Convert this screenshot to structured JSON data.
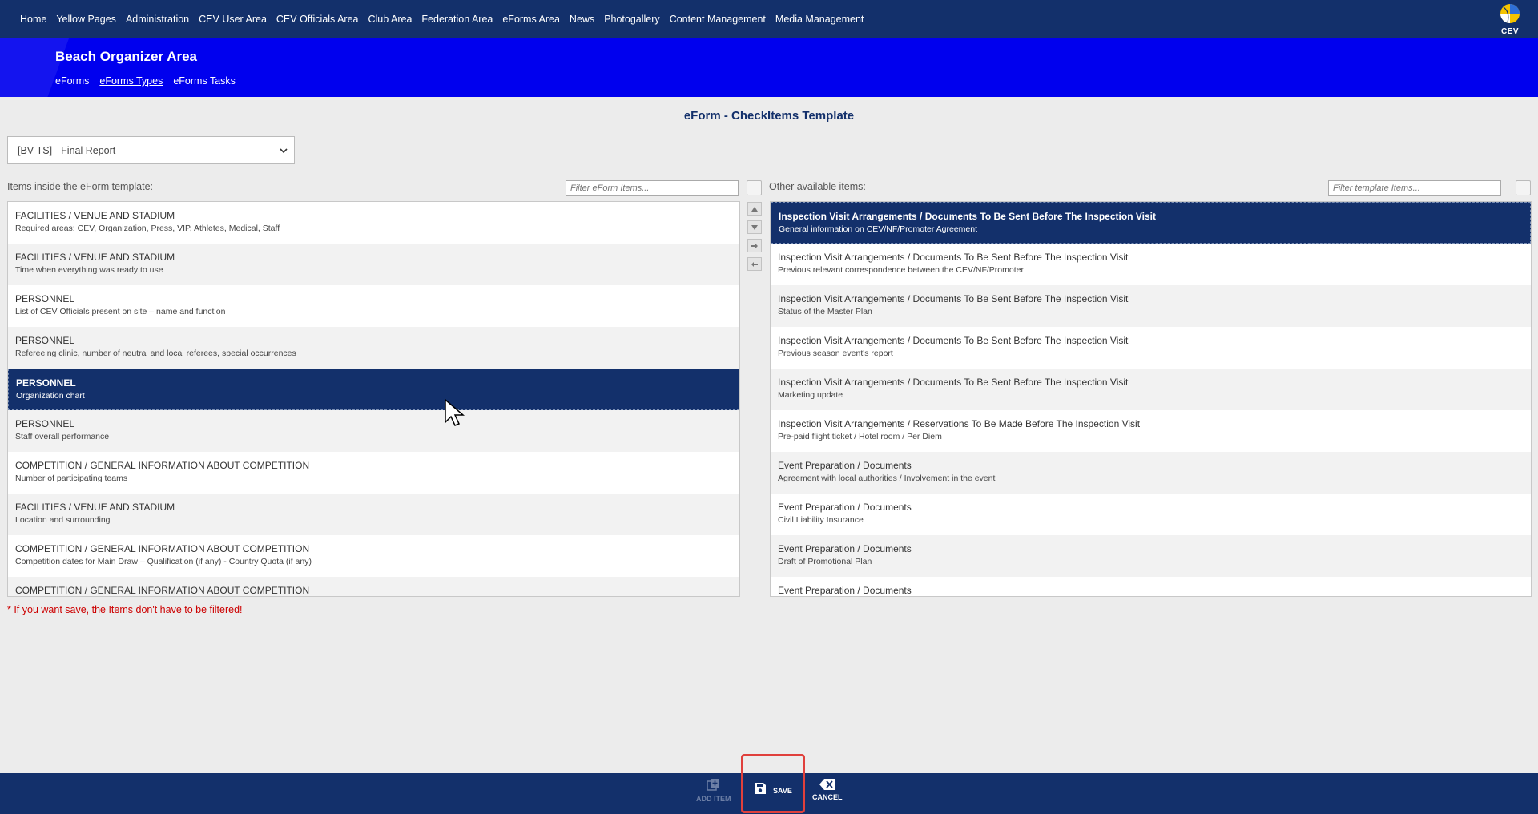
{
  "topnav": {
    "items": [
      "Home",
      "Yellow Pages",
      "Administration",
      "CEV User Area",
      "CEV Officials Area",
      "Club Area",
      "Federation Area",
      "eForms Area",
      "News",
      "Photogallery",
      "Content Management",
      "Media Management"
    ],
    "logo_text": "CEV"
  },
  "banner": {
    "title": "Beach Organizer Area",
    "links": [
      "eForms",
      "eForms Types",
      "eForms Tasks"
    ],
    "active_link": "eForms Types"
  },
  "page_title": "eForm - CheckItems Template",
  "form_select": {
    "value": "[BV-TS] - Final Report"
  },
  "left_panel": {
    "label": "Items inside the eForm template:",
    "filter_placeholder": "Filter eForm Items...",
    "items": [
      {
        "title": "FACILITIES / VENUE AND STADIUM",
        "sub": "Required areas: CEV, Organization, Press, VIP, Athletes, Medical, Staff",
        "selected": false
      },
      {
        "title": "FACILITIES / VENUE AND STADIUM",
        "sub": "Time when everything was ready to use",
        "selected": false
      },
      {
        "title": "PERSONNEL",
        "sub": "List of CEV Officials present on site – name and function",
        "selected": false
      },
      {
        "title": "PERSONNEL",
        "sub": "Refereeing clinic, number of neutral and local referees, special occurrences",
        "selected": false
      },
      {
        "title": "PERSONNEL",
        "sub": "Organization chart",
        "selected": true
      },
      {
        "title": "PERSONNEL",
        "sub": "Staff overall performance",
        "selected": false
      },
      {
        "title": "COMPETITION / GENERAL INFORMATION ABOUT COMPETITION",
        "sub": "Number of participating teams",
        "selected": false
      },
      {
        "title": "FACILITIES / VENUE AND STADIUM",
        "sub": "Location and surrounding",
        "selected": false
      },
      {
        "title": "COMPETITION / GENERAL INFORMATION ABOUT COMPETITION",
        "sub": "Competition dates for Main Draw – Qualification (if any) - Country Quota (if any)",
        "selected": false
      },
      {
        "title": "COMPETITION / GENERAL INFORMATION ABOUT COMPETITION",
        "sub": "",
        "selected": false
      }
    ]
  },
  "right_panel": {
    "label": "Other available items:",
    "filter_placeholder": "Filter template Items...",
    "items": [
      {
        "title": "Inspection Visit Arrangements / Documents To Be Sent Before The Inspection Visit",
        "sub": "General information on CEV/NF/Promoter Agreement",
        "selected": true
      },
      {
        "title": "Inspection Visit Arrangements / Documents To Be Sent Before The Inspection Visit",
        "sub": "Previous relevant correspondence between the CEV/NF/Promoter",
        "selected": false
      },
      {
        "title": "Inspection Visit Arrangements / Documents To Be Sent Before The Inspection Visit",
        "sub": "Status of the Master Plan",
        "selected": false
      },
      {
        "title": "Inspection Visit Arrangements / Documents To Be Sent Before The Inspection Visit",
        "sub": "Previous season event's report",
        "selected": false
      },
      {
        "title": "Inspection Visit Arrangements / Documents To Be Sent Before The Inspection Visit",
        "sub": "Marketing update",
        "selected": false
      },
      {
        "title": "Inspection Visit Arrangements / Reservations To Be Made Before The Inspection Visit",
        "sub": "Pre-paid flight ticket / Hotel room / Per Diem",
        "selected": false
      },
      {
        "title": "Event Preparation / Documents",
        "sub": "Agreement with local authorities / Involvement in the event",
        "selected": false
      },
      {
        "title": "Event Preparation / Documents",
        "sub": "Civil Liability Insurance",
        "selected": false
      },
      {
        "title": "Event Preparation / Documents",
        "sub": "Draft of Promotional Plan",
        "selected": false
      },
      {
        "title": "Event Preparation / Documents",
        "sub": "",
        "selected": false
      }
    ]
  },
  "note": "* If you want save, the Items don't have to be filtered!",
  "bottombar": {
    "add_item": "ADD ITEM",
    "save": "SAVE",
    "cancel": "CANCEL"
  },
  "icons": {
    "logo": "cev-volleyball-logo",
    "select": "chevron-down-icon",
    "move_up": "arrow-up-icon",
    "move_down": "arrow-down-icon",
    "move_right": "arrow-right-icon",
    "move_left": "arrow-left-icon",
    "add_item": "add-item-icon",
    "save": "floppy-disk-icon",
    "cancel": "backspace-x-icon",
    "cursor": "mouse-pointer-icon"
  },
  "colors": {
    "navy": "#13306b",
    "banner_blue": "#0000ee",
    "highlight_red": "#e0403c",
    "note_red": "#cc0000"
  }
}
